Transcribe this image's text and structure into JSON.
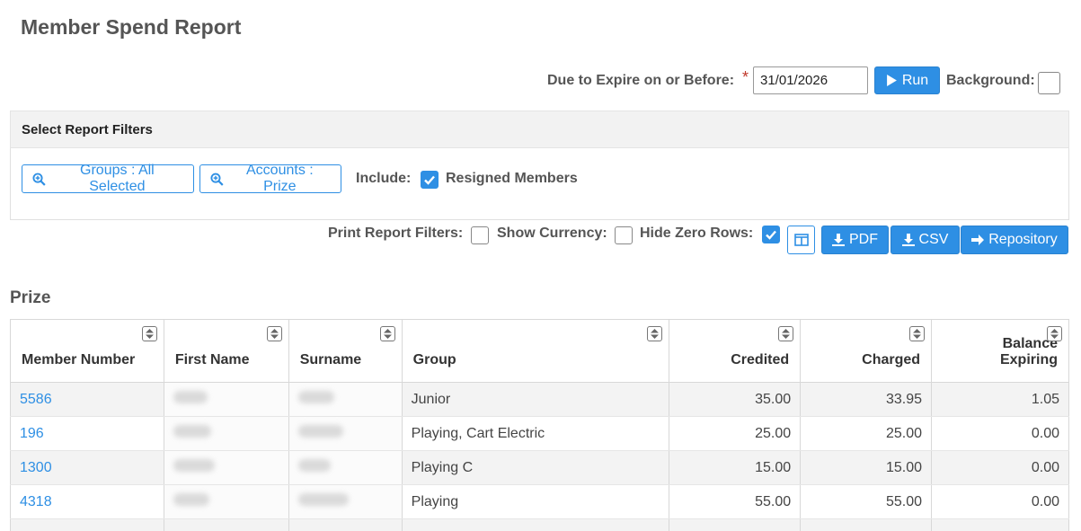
{
  "page": {
    "title": "Member Spend Report"
  },
  "expire": {
    "label": "Due to Expire on or Before:",
    "required_marker": "*",
    "date_value": "31/01/2026",
    "run_label": "Run",
    "background_label": "Background:",
    "background_checked": false
  },
  "filters": {
    "header": "Select Report Filters",
    "groups_label": "Groups : All Selected",
    "accounts_label": "Accounts : Prize",
    "include_label": "Include:",
    "resigned_label": "Resigned Members",
    "resigned_checked": true
  },
  "options": {
    "print_filters_label": "Print Report Filters:",
    "print_filters_checked": false,
    "show_currency_label": "Show Currency:",
    "show_currency_checked": false,
    "hide_zero_label": "Hide Zero Rows:",
    "hide_zero_checked": true,
    "pdf_label": "PDF",
    "csv_label": "CSV",
    "repository_label": "Repository"
  },
  "section": {
    "title": "Prize"
  },
  "table": {
    "headers": [
      "Member Number",
      "First Name",
      "Surname",
      "Group",
      "Credited",
      "Charged",
      "Balance Expiring"
    ],
    "rows": [
      {
        "member_number": "5586",
        "group": "Junior",
        "credited": "35.00",
        "charged": "33.95",
        "balance": "1.05"
      },
      {
        "member_number": "196",
        "group": "Playing, Cart Electric",
        "credited": "25.00",
        "charged": "25.00",
        "balance": "0.00"
      },
      {
        "member_number": "1300",
        "group": "Playing C",
        "credited": "15.00",
        "charged": "15.00",
        "balance": "0.00"
      },
      {
        "member_number": "4318",
        "group": "Playing",
        "credited": "55.00",
        "charged": "55.00",
        "balance": "0.00"
      }
    ]
  },
  "colors": {
    "accent": "#2e8fe4",
    "header_text": "#555555"
  },
  "icons": {
    "run": "play-icon",
    "groups": "zoom-in-icon",
    "accounts": "zoom-in-icon",
    "columns": "columns-icon",
    "pdf": "download-icon",
    "csv": "download-icon",
    "repository": "arrow-right-icon",
    "sort": "sort-icon"
  }
}
